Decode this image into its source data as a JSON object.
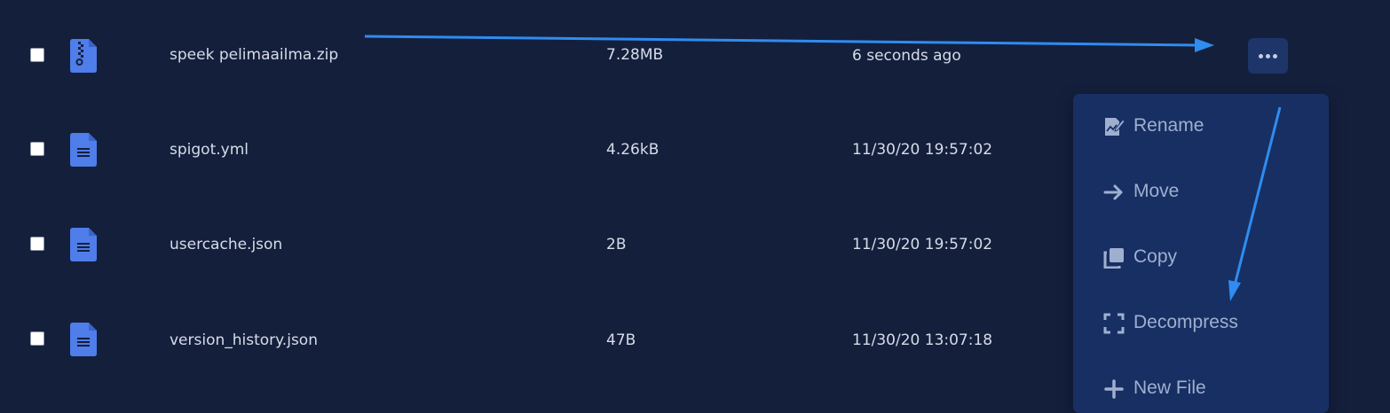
{
  "files": [
    {
      "name": "speek pelimaailma.zip",
      "size": "7.28MB",
      "modified": "6 seconds ago",
      "type": "zip"
    },
    {
      "name": "spigot.yml",
      "size": "4.26kB",
      "modified": "11/30/20 19:57:02",
      "type": "document"
    },
    {
      "name": "usercache.json",
      "size": "2B",
      "modified": "11/30/20 19:57:02",
      "type": "document"
    },
    {
      "name": "version_history.json",
      "size": "47B",
      "modified": "11/30/20 13:07:18",
      "type": "document"
    }
  ],
  "context_menu": {
    "items": [
      {
        "label": "Rename",
        "icon": "rename-icon"
      },
      {
        "label": "Move",
        "icon": "arrow-right-icon"
      },
      {
        "label": "Copy",
        "icon": "copy-icon"
      },
      {
        "label": "Decompress",
        "icon": "expand-icon"
      },
      {
        "label": "New File",
        "icon": "plus-icon"
      }
    ]
  },
  "colors": {
    "background": "#141f3c",
    "menu_background": "#172f63",
    "file_icon": "#4f7de9",
    "annotation_arrow": "#2f8cf0"
  }
}
